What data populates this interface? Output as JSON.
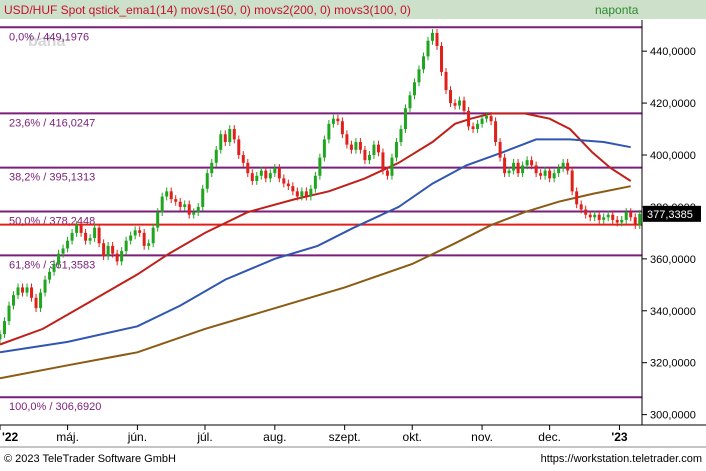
{
  "header": {
    "title": "USD/HUF Spot qstick_ema1(14) movs1(50, 0) movs2(200, 0) movs3(100, 0)",
    "period": "naponta"
  },
  "footer": {
    "copyright": "© 2023 TeleTrader Software GmbH",
    "url": "https://workstation.teletrader.com"
  },
  "watermark": "baha",
  "colors": {
    "background": "#ffffff",
    "header_bg": "#cde0c9",
    "header_text": "#c8102e",
    "period_text": "#2e8b2e",
    "fib_line": "#7a1e7a",
    "fib_label": "#7a1e7a",
    "support_line": "#e0201a",
    "candle_up": "#1fa51f",
    "candle_down": "#e0201a",
    "ma50": "#c0201a",
    "ma100": "#2f56b0",
    "ma200": "#8b5a14",
    "axis": "#000000",
    "price_tag_bg": "#000000",
    "price_tag_text": "#ffffff"
  },
  "chart_data": {
    "type": "candlestick",
    "title": "USD/HUF Spot",
    "xlim": [
      "2022-04-01",
      "2023-01-11"
    ],
    "ylim": [
      296,
      452
    ],
    "grid": false,
    "y_ticks": [
      "300,0000",
      "320,0000",
      "340,0000",
      "360,0000",
      "380,0000",
      "400,0000",
      "420,0000",
      "440,0000"
    ],
    "y_tick_values": [
      300,
      320,
      340,
      360,
      380,
      400,
      420,
      440
    ],
    "x_ticks": [
      {
        "label": "'22",
        "date": "2022-04-01"
      },
      {
        "label": "máj.",
        "date": "2022-05-01"
      },
      {
        "label": "jún.",
        "date": "2022-06-01"
      },
      {
        "label": "júl.",
        "date": "2022-07-01"
      },
      {
        "label": "aug.",
        "date": "2022-08-01"
      },
      {
        "label": "szept.",
        "date": "2022-09-01"
      },
      {
        "label": "okt.",
        "date": "2022-10-01"
      },
      {
        "label": "nov.",
        "date": "2022-11-01"
      },
      {
        "label": "dec.",
        "date": "2022-12-01"
      },
      {
        "label": "'23",
        "date": "2023-01-01"
      }
    ],
    "last_price": {
      "label": "377,3385",
      "value": 377.3385
    },
    "fibonacci_levels": [
      {
        "label": "0,0% / 449,1976",
        "value": 449.1976
      },
      {
        "label": "23,6% / 416,0247",
        "value": 416.0247
      },
      {
        "label": "38,2% / 395,1313",
        "value": 395.1313
      },
      {
        "label": "50,0% / 378,2448",
        "value": 378.2448
      },
      {
        "label": "61,8% / 361,3583",
        "value": 361.3583
      },
      {
        "label": "100,0% / 306,6920",
        "value": 306.692
      }
    ],
    "horizontal_lines": [
      {
        "value": 373.2
      }
    ],
    "candles_close": [
      {
        "date": "2022-04-01",
        "close": 331
      },
      {
        "date": "2022-04-03",
        "close": 336
      },
      {
        "date": "2022-04-05",
        "close": 342
      },
      {
        "date": "2022-04-07",
        "close": 346
      },
      {
        "date": "2022-04-09",
        "close": 349
      },
      {
        "date": "2022-04-11",
        "close": 347
      },
      {
        "date": "2022-04-13",
        "close": 349
      },
      {
        "date": "2022-04-15",
        "close": 345
      },
      {
        "date": "2022-04-17",
        "close": 341
      },
      {
        "date": "2022-04-19",
        "close": 347
      },
      {
        "date": "2022-04-21",
        "close": 352
      },
      {
        "date": "2022-04-23",
        "close": 355
      },
      {
        "date": "2022-04-25",
        "close": 358
      },
      {
        "date": "2022-04-27",
        "close": 362
      },
      {
        "date": "2022-04-29",
        "close": 364
      },
      {
        "date": "2022-05-01",
        "close": 367
      },
      {
        "date": "2022-05-03",
        "close": 370
      },
      {
        "date": "2022-05-05",
        "close": 373
      },
      {
        "date": "2022-05-07",
        "close": 370
      },
      {
        "date": "2022-05-09",
        "close": 367
      },
      {
        "date": "2022-05-11",
        "close": 368
      },
      {
        "date": "2022-05-13",
        "close": 372
      },
      {
        "date": "2022-05-15",
        "close": 366
      },
      {
        "date": "2022-05-17",
        "close": 361
      },
      {
        "date": "2022-05-19",
        "close": 365
      },
      {
        "date": "2022-05-21",
        "close": 362
      },
      {
        "date": "2022-05-23",
        "close": 359
      },
      {
        "date": "2022-05-25",
        "close": 363
      },
      {
        "date": "2022-05-27",
        "close": 367
      },
      {
        "date": "2022-05-29",
        "close": 369
      },
      {
        "date": "2022-05-31",
        "close": 371
      },
      {
        "date": "2022-06-02",
        "close": 370
      },
      {
        "date": "2022-06-04",
        "close": 365
      },
      {
        "date": "2022-06-06",
        "close": 366
      },
      {
        "date": "2022-06-08",
        "close": 372
      },
      {
        "date": "2022-06-10",
        "close": 378
      },
      {
        "date": "2022-06-12",
        "close": 384
      },
      {
        "date": "2022-06-14",
        "close": 386
      },
      {
        "date": "2022-06-16",
        "close": 383
      },
      {
        "date": "2022-06-18",
        "close": 382
      },
      {
        "date": "2022-06-20",
        "close": 380
      },
      {
        "date": "2022-06-22",
        "close": 381
      },
      {
        "date": "2022-06-24",
        "close": 377
      },
      {
        "date": "2022-06-26",
        "close": 378
      },
      {
        "date": "2022-06-28",
        "close": 380
      },
      {
        "date": "2022-06-30",
        "close": 387
      },
      {
        "date": "2022-07-02",
        "close": 393
      },
      {
        "date": "2022-07-04",
        "close": 397
      },
      {
        "date": "2022-07-06",
        "close": 402
      },
      {
        "date": "2022-07-08",
        "close": 408
      },
      {
        "date": "2022-07-10",
        "close": 405
      },
      {
        "date": "2022-07-12",
        "close": 410
      },
      {
        "date": "2022-07-14",
        "close": 406
      },
      {
        "date": "2022-07-16",
        "close": 400
      },
      {
        "date": "2022-07-18",
        "close": 397
      },
      {
        "date": "2022-07-20",
        "close": 393
      },
      {
        "date": "2022-07-22",
        "close": 390
      },
      {
        "date": "2022-07-24",
        "close": 392
      },
      {
        "date": "2022-07-26",
        "close": 394
      },
      {
        "date": "2022-07-28",
        "close": 391
      },
      {
        "date": "2022-07-30",
        "close": 393
      },
      {
        "date": "2022-08-01",
        "close": 395
      },
      {
        "date": "2022-08-03",
        "close": 391
      },
      {
        "date": "2022-08-05",
        "close": 389
      },
      {
        "date": "2022-08-07",
        "close": 388
      },
      {
        "date": "2022-08-09",
        "close": 386
      },
      {
        "date": "2022-08-11",
        "close": 384
      },
      {
        "date": "2022-08-13",
        "close": 386
      },
      {
        "date": "2022-08-15",
        "close": 384
      },
      {
        "date": "2022-08-17",
        "close": 387
      },
      {
        "date": "2022-08-19",
        "close": 392
      },
      {
        "date": "2022-08-21",
        "close": 399
      },
      {
        "date": "2022-08-23",
        "close": 406
      },
      {
        "date": "2022-08-25",
        "close": 412
      },
      {
        "date": "2022-08-27",
        "close": 414
      },
      {
        "date": "2022-08-29",
        "close": 413
      },
      {
        "date": "2022-08-31",
        "close": 408
      },
      {
        "date": "2022-09-02",
        "close": 404
      },
      {
        "date": "2022-09-04",
        "close": 402
      },
      {
        "date": "2022-09-06",
        "close": 405
      },
      {
        "date": "2022-09-08",
        "close": 402
      },
      {
        "date": "2022-09-10",
        "close": 398
      },
      {
        "date": "2022-09-12",
        "close": 400
      },
      {
        "date": "2022-09-14",
        "close": 404
      },
      {
        "date": "2022-09-16",
        "close": 401
      },
      {
        "date": "2022-09-18",
        "close": 394
      },
      {
        "date": "2022-09-20",
        "close": 392
      },
      {
        "date": "2022-09-22",
        "close": 399
      },
      {
        "date": "2022-09-24",
        "close": 405
      },
      {
        "date": "2022-09-26",
        "close": 410
      },
      {
        "date": "2022-09-28",
        "close": 418
      },
      {
        "date": "2022-09-30",
        "close": 423
      },
      {
        "date": "2022-10-02",
        "close": 428
      },
      {
        "date": "2022-10-04",
        "close": 433
      },
      {
        "date": "2022-10-06",
        "close": 438
      },
      {
        "date": "2022-10-08",
        "close": 444
      },
      {
        "date": "2022-10-10",
        "close": 447
      },
      {
        "date": "2022-10-12",
        "close": 442
      },
      {
        "date": "2022-10-14",
        "close": 432
      },
      {
        "date": "2022-10-16",
        "close": 425
      },
      {
        "date": "2022-10-18",
        "close": 420
      },
      {
        "date": "2022-10-20",
        "close": 419
      },
      {
        "date": "2022-10-22",
        "close": 421
      },
      {
        "date": "2022-10-24",
        "close": 417
      },
      {
        "date": "2022-10-26",
        "close": 411
      },
      {
        "date": "2022-10-28",
        "close": 410
      },
      {
        "date": "2022-10-30",
        "close": 412
      },
      {
        "date": "2022-11-01",
        "close": 414
      },
      {
        "date": "2022-11-03",
        "close": 415
      },
      {
        "date": "2022-11-05",
        "close": 413
      },
      {
        "date": "2022-11-07",
        "close": 405
      },
      {
        "date": "2022-11-09",
        "close": 399
      },
      {
        "date": "2022-11-11",
        "close": 393
      },
      {
        "date": "2022-11-13",
        "close": 394
      },
      {
        "date": "2022-11-15",
        "close": 397
      },
      {
        "date": "2022-11-17",
        "close": 393
      },
      {
        "date": "2022-11-19",
        "close": 396
      },
      {
        "date": "2022-11-21",
        "close": 398
      },
      {
        "date": "2022-11-23",
        "close": 396
      },
      {
        "date": "2022-11-25",
        "close": 393
      },
      {
        "date": "2022-11-27",
        "close": 392
      },
      {
        "date": "2022-11-29",
        "close": 394
      },
      {
        "date": "2022-12-01",
        "close": 391
      },
      {
        "date": "2022-12-03",
        "close": 393
      },
      {
        "date": "2022-12-05",
        "close": 395
      },
      {
        "date": "2022-12-07",
        "close": 397
      },
      {
        "date": "2022-12-09",
        "close": 394
      },
      {
        "date": "2022-12-11",
        "close": 386
      },
      {
        "date": "2022-12-13",
        "close": 381
      },
      {
        "date": "2022-12-15",
        "close": 379
      },
      {
        "date": "2022-12-17",
        "close": 377
      },
      {
        "date": "2022-12-19",
        "close": 376
      },
      {
        "date": "2022-12-21",
        "close": 377
      },
      {
        "date": "2022-12-23",
        "close": 375
      },
      {
        "date": "2022-12-25",
        "close": 376
      },
      {
        "date": "2022-12-27",
        "close": 377
      },
      {
        "date": "2022-12-29",
        "close": 375
      },
      {
        "date": "2022-12-31",
        "close": 374
      },
      {
        "date": "2023-01-02",
        "close": 375
      },
      {
        "date": "2023-01-04",
        "close": 378
      },
      {
        "date": "2023-01-06",
        "close": 376
      },
      {
        "date": "2023-01-08",
        "close": 373
      },
      {
        "date": "2023-01-10",
        "close": 377.3385
      }
    ],
    "series": [
      {
        "name": "movs1(50, 0)",
        "color_key": "ma50",
        "points": [
          {
            "date": "2022-04-01",
            "value": 327
          },
          {
            "date": "2022-04-20",
            "value": 333
          },
          {
            "date": "2022-05-10",
            "value": 343
          },
          {
            "date": "2022-06-01",
            "value": 354
          },
          {
            "date": "2022-06-15",
            "value": 362
          },
          {
            "date": "2022-07-01",
            "value": 370
          },
          {
            "date": "2022-07-20",
            "value": 378
          },
          {
            "date": "2022-08-10",
            "value": 383
          },
          {
            "date": "2022-08-25",
            "value": 386
          },
          {
            "date": "2022-09-10",
            "value": 391
          },
          {
            "date": "2022-09-25",
            "value": 397
          },
          {
            "date": "2022-10-10",
            "value": 405
          },
          {
            "date": "2022-10-20",
            "value": 412
          },
          {
            "date": "2022-10-27",
            "value": 414
          },
          {
            "date": "2022-11-05",
            "value": 416
          },
          {
            "date": "2022-11-20",
            "value": 416
          },
          {
            "date": "2022-12-01",
            "value": 414
          },
          {
            "date": "2022-12-10",
            "value": 410
          },
          {
            "date": "2022-12-20",
            "value": 401
          },
          {
            "date": "2022-12-28",
            "value": 395
          },
          {
            "date": "2023-01-06",
            "value": 390
          }
        ]
      },
      {
        "name": "movs2(200, 0)",
        "color_key": "ma200",
        "points": [
          {
            "date": "2022-04-01",
            "value": 314
          },
          {
            "date": "2022-05-01",
            "value": 319
          },
          {
            "date": "2022-06-01",
            "value": 324
          },
          {
            "date": "2022-07-01",
            "value": 333
          },
          {
            "date": "2022-08-01",
            "value": 341
          },
          {
            "date": "2022-09-01",
            "value": 349
          },
          {
            "date": "2022-10-01",
            "value": 358
          },
          {
            "date": "2022-10-20",
            "value": 366
          },
          {
            "date": "2022-11-05",
            "value": 373
          },
          {
            "date": "2022-11-20",
            "value": 378
          },
          {
            "date": "2022-12-05",
            "value": 382
          },
          {
            "date": "2022-12-20",
            "value": 385
          },
          {
            "date": "2023-01-06",
            "value": 388
          }
        ]
      },
      {
        "name": "movs3(100, 0)",
        "color_key": "ma100",
        "points": [
          {
            "date": "2022-04-01",
            "value": 324
          },
          {
            "date": "2022-05-01",
            "value": 328
          },
          {
            "date": "2022-06-01",
            "value": 334
          },
          {
            "date": "2022-06-20",
            "value": 342
          },
          {
            "date": "2022-07-10",
            "value": 352
          },
          {
            "date": "2022-08-01",
            "value": 360
          },
          {
            "date": "2022-08-20",
            "value": 365
          },
          {
            "date": "2022-09-05",
            "value": 372
          },
          {
            "date": "2022-09-25",
            "value": 380
          },
          {
            "date": "2022-10-10",
            "value": 389
          },
          {
            "date": "2022-10-25",
            "value": 396
          },
          {
            "date": "2022-11-10",
            "value": 401
          },
          {
            "date": "2022-11-25",
            "value": 406
          },
          {
            "date": "2022-12-10",
            "value": 406
          },
          {
            "date": "2022-12-25",
            "value": 405
          },
          {
            "date": "2023-01-06",
            "value": 403
          }
        ]
      }
    ]
  }
}
